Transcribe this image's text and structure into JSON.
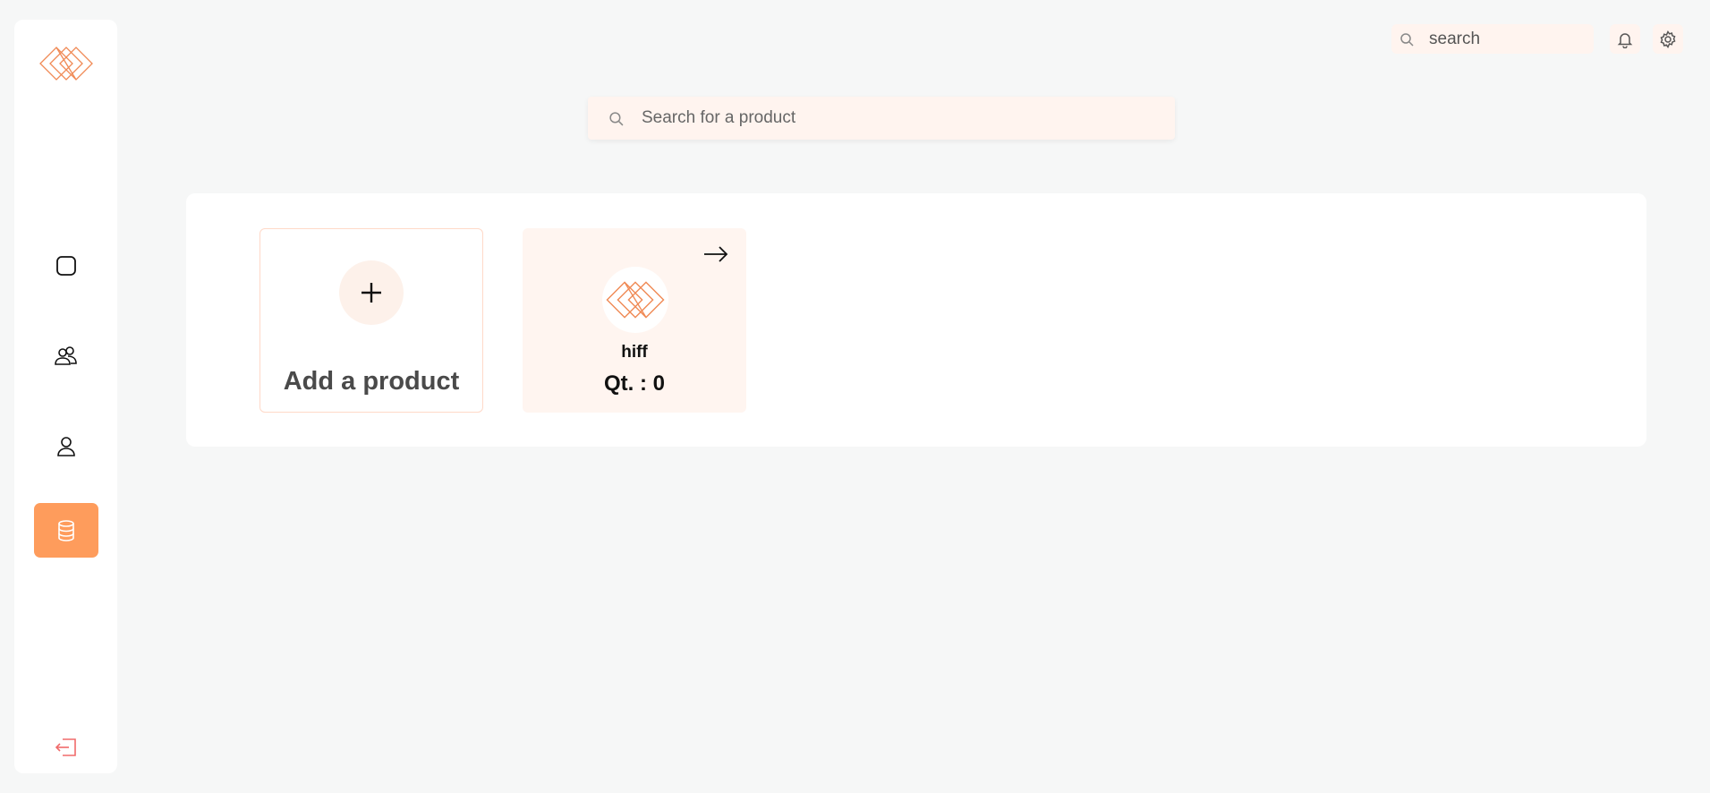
{
  "sidebar": {
    "items": [
      {
        "icon": "square-icon",
        "active": false
      },
      {
        "icon": "users-icon",
        "active": false
      },
      {
        "icon": "user-icon",
        "active": false
      },
      {
        "icon": "database-icon",
        "active": true
      }
    ],
    "logout_icon": "logout-icon"
  },
  "header": {
    "search": {
      "placeholder": "search"
    },
    "notification_icon": "bell-icon",
    "settings_icon": "gear-icon"
  },
  "main": {
    "search": {
      "placeholder": "Search for a product"
    },
    "add_card": {
      "label": "Add a product"
    },
    "products": [
      {
        "name": "hiff",
        "qty_label": "Qt. : 0",
        "quantity": 0
      }
    ]
  },
  "colors": {
    "accent": "#fe9c5c",
    "accent_light": "#fff4ef",
    "logout": "#f06b6b"
  }
}
